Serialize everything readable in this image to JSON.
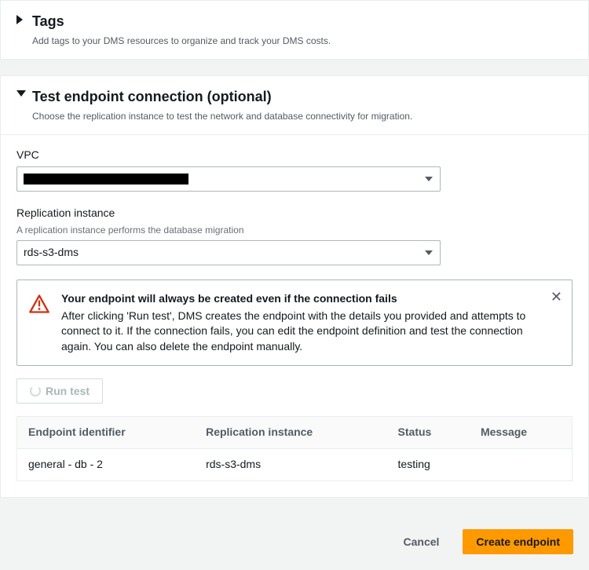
{
  "tags_panel": {
    "title": "Tags",
    "subtitle": "Add tags to your DMS resources to organize and track your DMS costs."
  },
  "test_panel": {
    "title": "Test endpoint connection (optional)",
    "subtitle": "Choose the replication instance to test the network and database connectivity for migration.",
    "vpc_label": "VPC",
    "vpc_value": "",
    "ri_label": "Replication instance",
    "ri_hint": "A replication instance performs the database migration",
    "ri_value": "rds-s3-dms",
    "alert_title": "Your endpoint will always be created even if the connection fails",
    "alert_body": "After clicking 'Run test', DMS creates the endpoint with the details you provided and attempts to connect to it. If the connection fails, you can edit the endpoint definition and test the connection again. You can also delete the endpoint manually.",
    "run_test_label": "Run test",
    "table": {
      "headers": {
        "endpoint": "Endpoint identifier",
        "ri": "Replication instance",
        "status": "Status",
        "message": "Message"
      },
      "row": {
        "endpoint": "general - db - 2",
        "ri": "rds-s3-dms",
        "status": "testing",
        "message": ""
      }
    }
  },
  "footer": {
    "cancel": "Cancel",
    "create": "Create endpoint"
  }
}
